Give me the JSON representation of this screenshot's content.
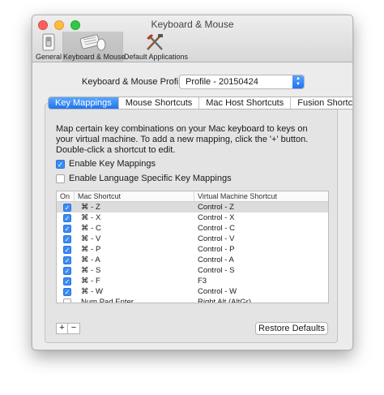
{
  "window": {
    "title": "Keyboard & Mouse"
  },
  "toolbar": {
    "items": [
      {
        "label": "General"
      },
      {
        "label": "Keyboard & Mouse",
        "selected": true
      },
      {
        "label": "Default Applications"
      }
    ]
  },
  "profile": {
    "label": "Keyboard & Mouse Profile:",
    "value": "Profile - 20150424"
  },
  "tabs": [
    {
      "label": "Key Mappings",
      "active": true
    },
    {
      "label": "Mouse Shortcuts"
    },
    {
      "label": "Mac Host Shortcuts"
    },
    {
      "label": "Fusion Shortcuts"
    }
  ],
  "description": "Map certain key combinations on your Mac keyboard to keys on your virtual machine. To add a new mapping, click the '+' button. Double-click a shortcut to edit.",
  "checks": {
    "enable_key_mappings": {
      "label": "Enable Key Mappings",
      "checked": true
    },
    "enable_language": {
      "label": "Enable Language Specific Key Mappings",
      "checked": false
    }
  },
  "table": {
    "headers": {
      "on": "On",
      "mac": "Mac Shortcut",
      "vm": "Virtual Machine Shortcut"
    },
    "rows": [
      {
        "on": true,
        "mac": "⌘ - Z",
        "vm": "Control - Z",
        "selected": true
      },
      {
        "on": true,
        "mac": "⌘ - X",
        "vm": "Control - X"
      },
      {
        "on": true,
        "mac": "⌘ - C",
        "vm": "Control - C"
      },
      {
        "on": true,
        "mac": "⌘ - V",
        "vm": "Control - V"
      },
      {
        "on": true,
        "mac": "⌘ - P",
        "vm": "Control - P"
      },
      {
        "on": true,
        "mac": "⌘ - A",
        "vm": "Control - A"
      },
      {
        "on": true,
        "mac": "⌘ - S",
        "vm": "Control - S"
      },
      {
        "on": true,
        "mac": "⌘ - F",
        "vm": "F3"
      },
      {
        "on": true,
        "mac": "⌘ - W",
        "vm": "Control - W"
      },
      {
        "on": false,
        "mac": "Num Pad Enter",
        "vm": "Right Alt (AltGr)"
      }
    ]
  },
  "buttons": {
    "add": "+",
    "remove": "−",
    "restore": "Restore Defaults"
  },
  "colors": {
    "accent": "#2f80f3",
    "close": "#fc605c",
    "minimize": "#fdbc40",
    "maximize": "#34c84a"
  },
  "icons": {
    "checkmark": "✓",
    "select_arrows": "chevron-updown-icon"
  }
}
